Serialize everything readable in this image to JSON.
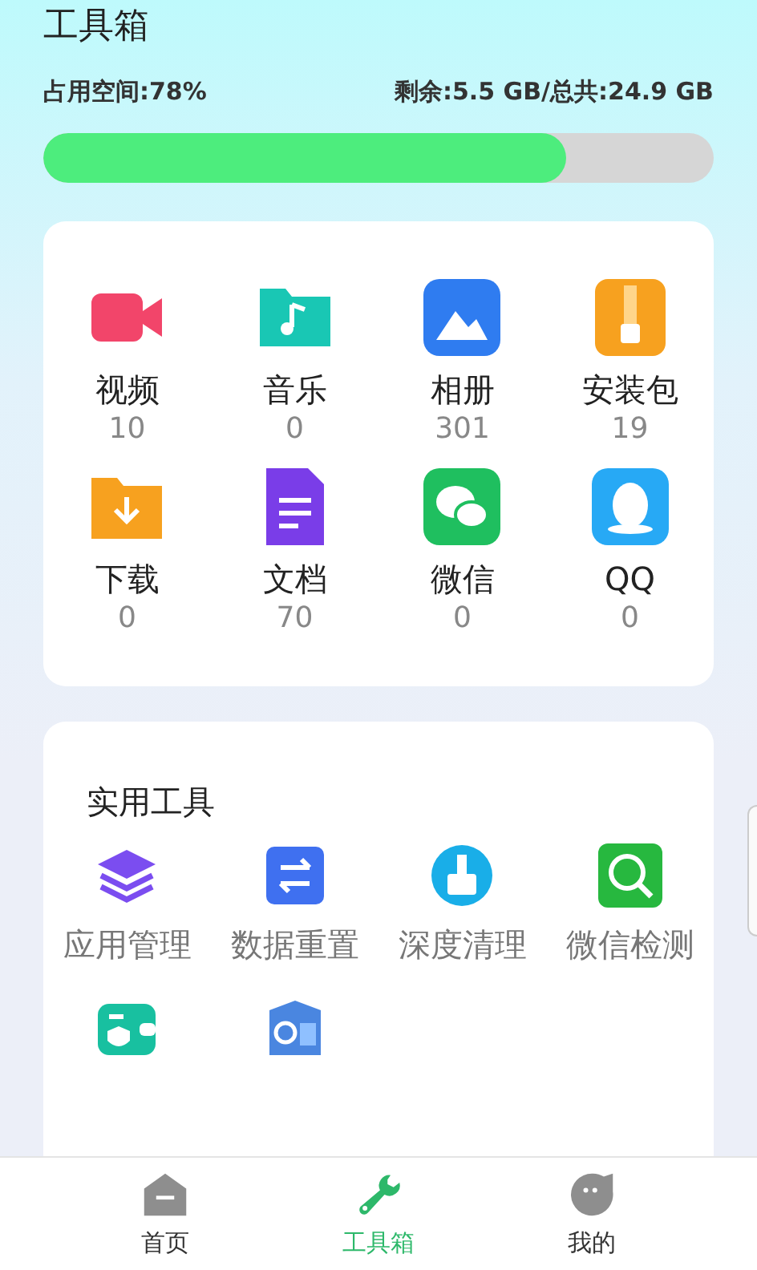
{
  "header": {
    "title": "工具箱"
  },
  "storage": {
    "used_label": "占用空间:78%",
    "free_label": "剩余:5.5 GB/总共:24.9 GB",
    "level": 0.78
  },
  "categories": [
    {
      "label": "视频",
      "count": "10"
    },
    {
      "label": "音乐",
      "count": "0"
    },
    {
      "label": "相册",
      "count": "301"
    },
    {
      "label": "安装包",
      "count": "19"
    },
    {
      "label": "下载",
      "count": "0"
    },
    {
      "label": "文档",
      "count": "70"
    },
    {
      "label": "微信",
      "count": "0"
    },
    {
      "label": "QQ",
      "count": "0"
    }
  ],
  "tools": {
    "title": "实用工具",
    "items": [
      {
        "kind": "labeled",
        "label": "应用管理"
      },
      {
        "kind": "labeled",
        "label": "数据重置"
      },
      {
        "kind": "labeled",
        "label": "深度清理"
      },
      {
        "kind": "labeled",
        "label": "微信检测"
      },
      {
        "kind": "icon_only"
      },
      {
        "kind": "icon_only"
      }
    ]
  },
  "tab_bar": [
    {
      "label": "首页",
      "selected": false
    },
    {
      "label": "工具箱",
      "selected": true
    },
    {
      "label": "我的",
      "selected": false
    }
  ]
}
